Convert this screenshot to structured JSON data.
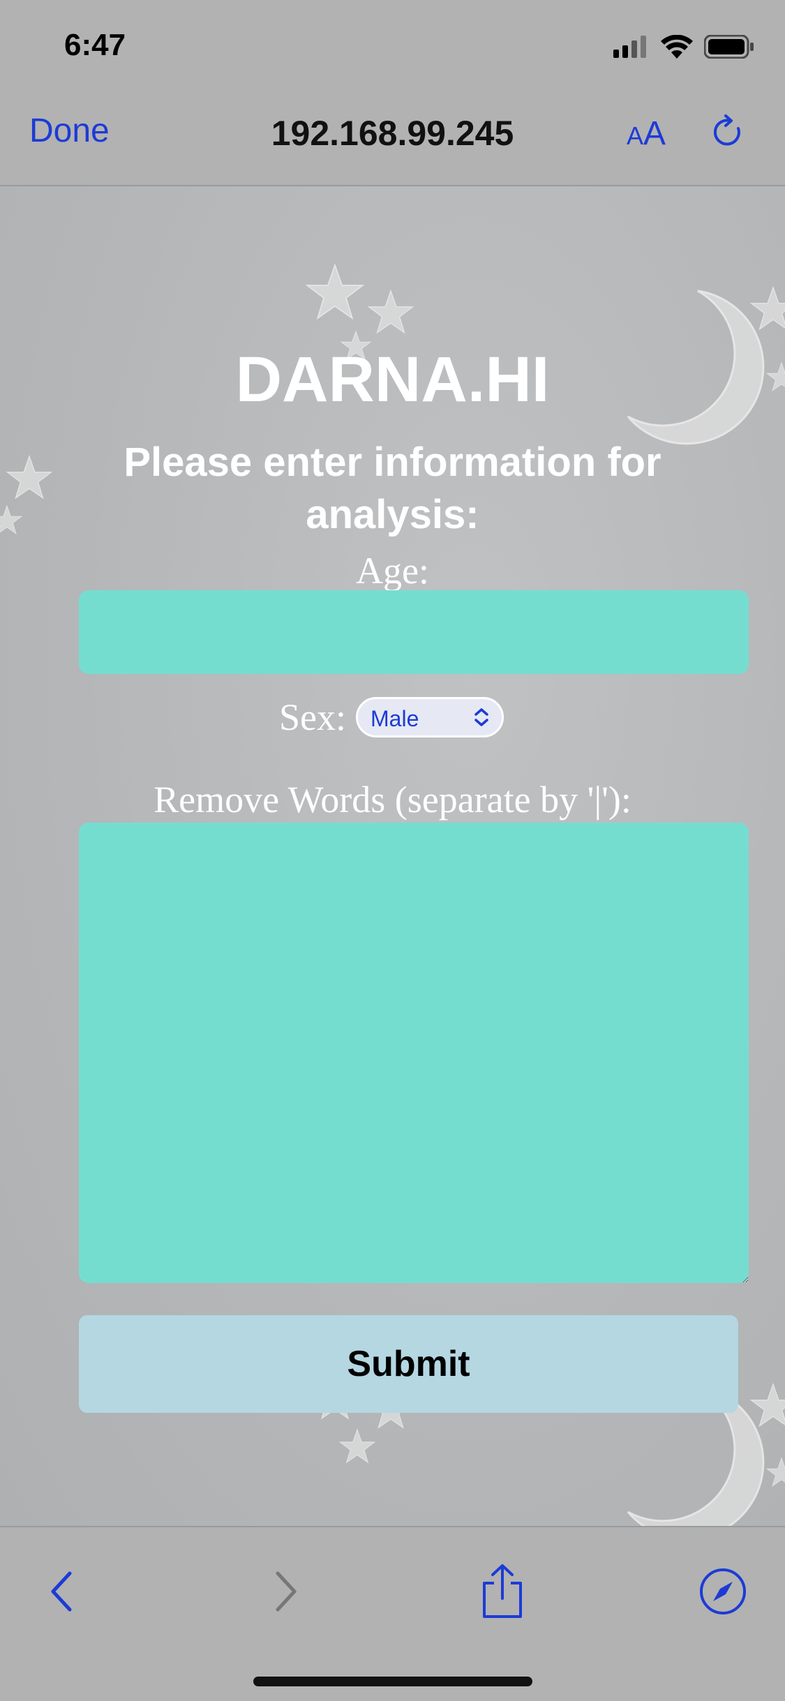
{
  "status_bar": {
    "time": "6:47",
    "icons": [
      "cellular-signal-icon",
      "wifi-icon",
      "battery-icon"
    ]
  },
  "browser": {
    "done_label": "Done",
    "url": "192.168.99.245",
    "text_size_small": "A",
    "text_size_large": "A",
    "reload_icon": "reload-icon"
  },
  "page": {
    "title": "DARNA.HI",
    "instructions": "Please enter information for analysis:",
    "age_label": "Age:",
    "age_value": "",
    "sex_label": "Sex:",
    "sex_selected": "Male",
    "remove_words_label": "Remove Words (separate by '|'):",
    "remove_words_value": "",
    "submit_label": "Submit"
  },
  "toolbar": {
    "icons": [
      "back-icon",
      "forward-icon",
      "share-icon",
      "compass-icon"
    ]
  },
  "colors": {
    "accent": "#1c3bd6",
    "input_fill": "#75ddd0",
    "submit_fill": "#b4d7e2",
    "background": "#b4b6b8"
  }
}
